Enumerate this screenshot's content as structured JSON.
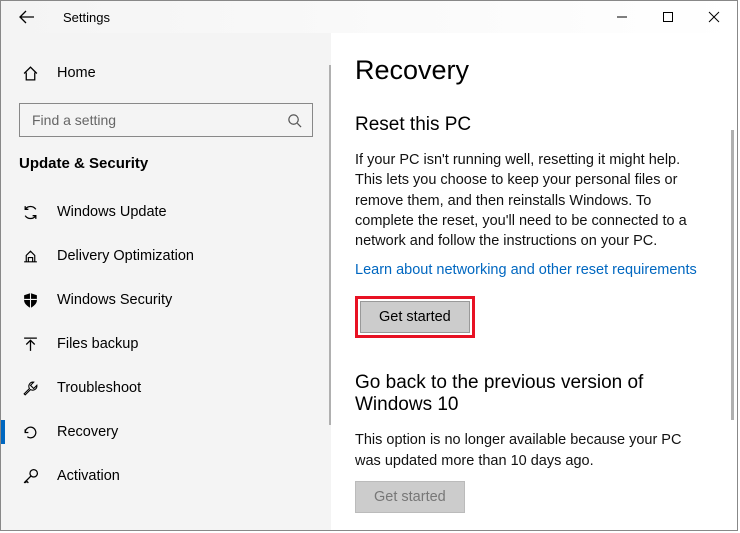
{
  "titlebar": {
    "title": "Settings"
  },
  "sidebar": {
    "home_label": "Home",
    "search_placeholder": "Find a setting",
    "section_title": "Update & Security",
    "items": [
      {
        "label": "Windows Update"
      },
      {
        "label": "Delivery Optimization"
      },
      {
        "label": "Windows Security"
      },
      {
        "label": "Files backup"
      },
      {
        "label": "Troubleshoot"
      },
      {
        "label": "Recovery"
      },
      {
        "label": "Activation"
      }
    ]
  },
  "content": {
    "page_title": "Recovery",
    "reset": {
      "heading": "Reset this PC",
      "body": "If your PC isn't running well, resetting it might help. This lets you choose to keep your personal files or remove them, and then reinstalls Windows. To complete the reset, you'll need to be connected to a network and follow the instructions on your PC.",
      "link": "Learn about networking and other reset requirements",
      "button": "Get started"
    },
    "goback": {
      "heading": "Go back to the previous version of Windows 10",
      "body": "This option is no longer available because your PC was updated more than 10 days ago.",
      "button": "Get started"
    }
  }
}
